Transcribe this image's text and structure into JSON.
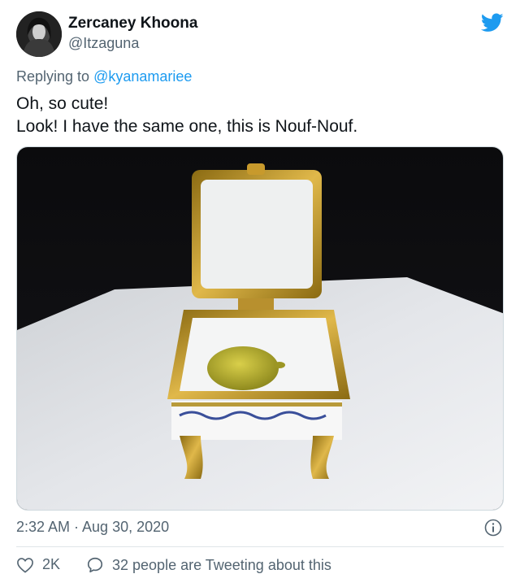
{
  "author": {
    "name": "Zercaney Khoona",
    "handle": "@Itzaguna"
  },
  "reply": {
    "prefix": "Replying to ",
    "mention": "@kyanamariee"
  },
  "tweet": {
    "line1": "Oh, so cute!",
    "line2": "Look! I have the same one, this is Nouf-Nouf."
  },
  "meta": {
    "timestamp": "2:32 AM · Aug 30, 2020"
  },
  "actions": {
    "likes": "2K",
    "tweeting": "32 people are Tweeting about this"
  },
  "colors": {
    "accent": "#1d9bf0",
    "secondary_text": "#536471",
    "primary_text": "#0f1419"
  },
  "icons": [
    "twitter-bird-icon",
    "info-icon",
    "heart-icon",
    "comment-bubble-icon"
  ]
}
